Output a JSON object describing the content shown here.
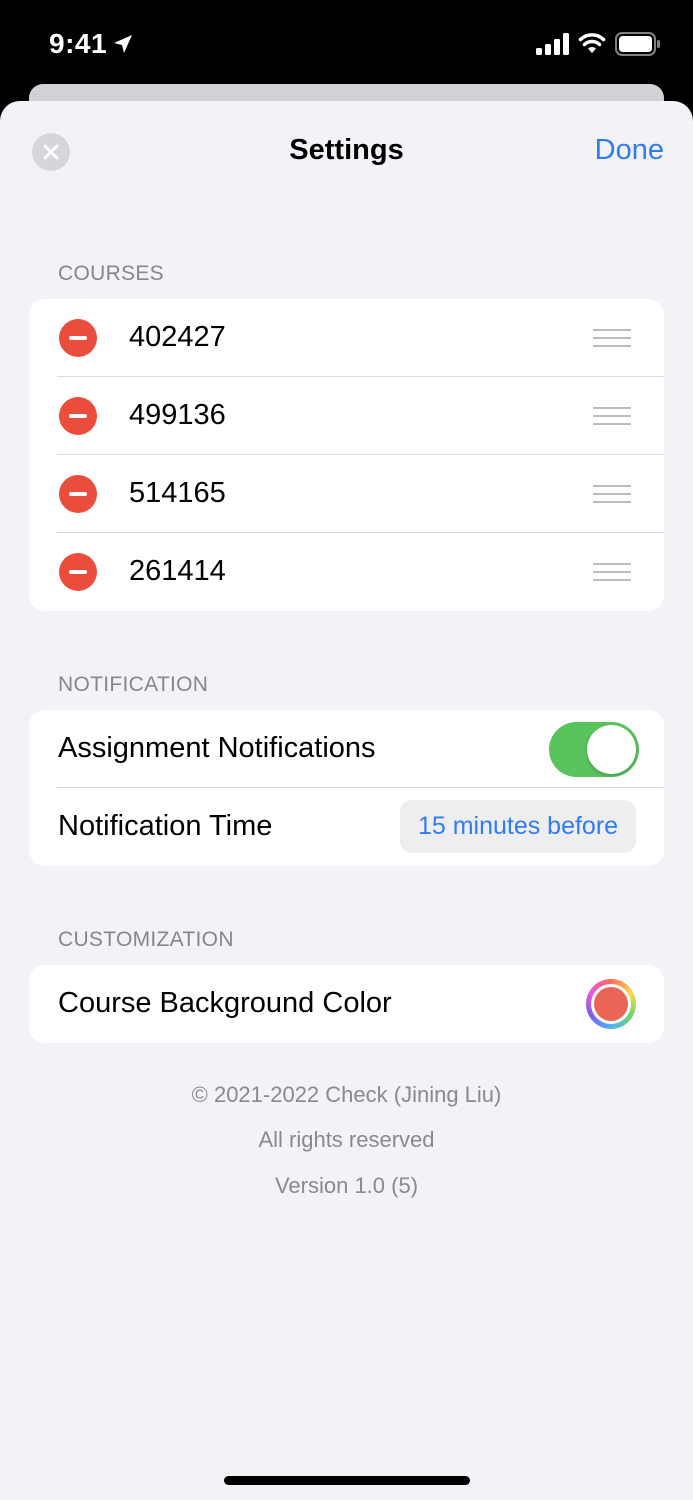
{
  "status_bar": {
    "time": "9:41"
  },
  "nav": {
    "title": "Settings",
    "done_label": "Done"
  },
  "sections": {
    "courses": {
      "header": "COURSES",
      "items": [
        "402427",
        "499136",
        "514165",
        "261414"
      ]
    },
    "notification": {
      "header": "NOTIFICATION",
      "assignment_label": "Assignment Notifications",
      "assignment_enabled": true,
      "time_label": "Notification Time",
      "time_value": "15 minutes before"
    },
    "customization": {
      "header": "CUSTOMIZATION",
      "color_label": "Course Background Color",
      "selected_color": "#eb6556"
    }
  },
  "footer": {
    "copyright": "© 2021-2022 Check (Jining Liu)",
    "rights": "All rights reserved",
    "version": "Version 1.0 (5)"
  },
  "colors": {
    "accent": "#2f7cf6",
    "delete": "#eb4d3d",
    "toggle_on": "#5ac35e"
  }
}
